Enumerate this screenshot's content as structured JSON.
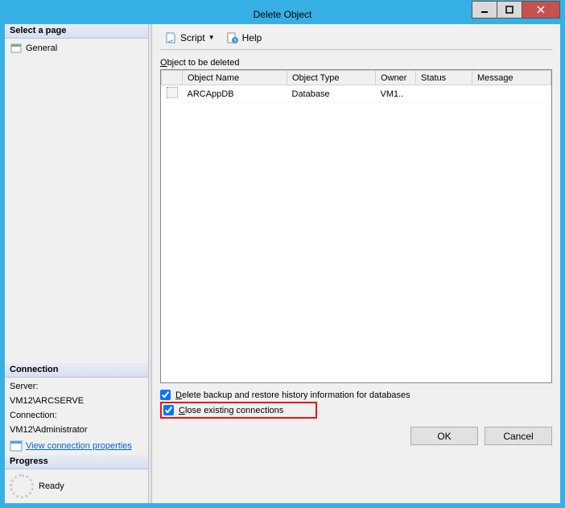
{
  "title": "Delete Object",
  "left": {
    "selectPageHdr": "Select a page",
    "page0": "General",
    "connectionHdr": "Connection",
    "serverLbl": "Server:",
    "serverVal": "VM12\\ARCSERVE",
    "connLbl": "Connection:",
    "connVal": "VM12\\Administrator",
    "viewPropsLink": "View connection properties",
    "progressHdr": "Progress",
    "progressStatus": "Ready"
  },
  "toolbar": {
    "script": "Script",
    "help": "Help"
  },
  "gridLabel": "Object to be deleted",
  "cols": {
    "name": "Object Name",
    "type": "Object Type",
    "owner": "Owner",
    "status": "Status",
    "message": "Message"
  },
  "row0": {
    "name": "ARCAppDB",
    "type": "Database",
    "owner": "VM1..",
    "status": "",
    "message": ""
  },
  "checks": {
    "deleteHistory": "Delete backup and restore history information for databases",
    "closeConns": "Close existing connections"
  },
  "buttons": {
    "ok": "OK",
    "cancel": "Cancel"
  }
}
